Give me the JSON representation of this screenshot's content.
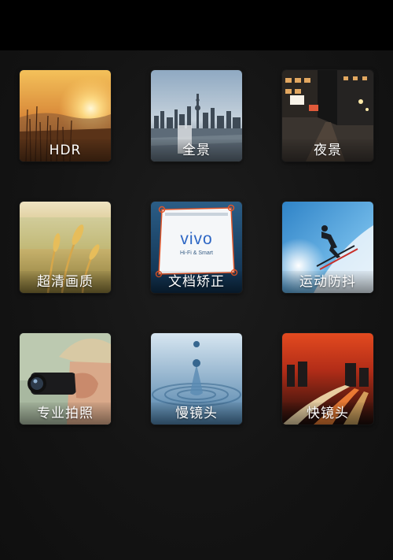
{
  "modes": [
    {
      "label": "HDR",
      "icon": "sunset-field-icon"
    },
    {
      "label": "全景",
      "icon": "city-skyline-icon"
    },
    {
      "label": "夜景",
      "icon": "night-street-icon"
    },
    {
      "label": "超清画质",
      "icon": "wheat-field-icon"
    },
    {
      "label": "文档矫正",
      "icon": "document-frame-icon",
      "doc_brand": "vivo",
      "doc_tagline": "Hi-Fi & Smart"
    },
    {
      "label": "运动防抖",
      "icon": "skier-icon"
    },
    {
      "label": "专业拍照",
      "icon": "photographer-icon"
    },
    {
      "label": "慢镜头",
      "icon": "water-drop-icon"
    },
    {
      "label": "快镜头",
      "icon": "light-trails-icon"
    }
  ],
  "colors": {
    "background": "#141414",
    "label_text": "#ffffff",
    "accent": "#e0562a"
  }
}
